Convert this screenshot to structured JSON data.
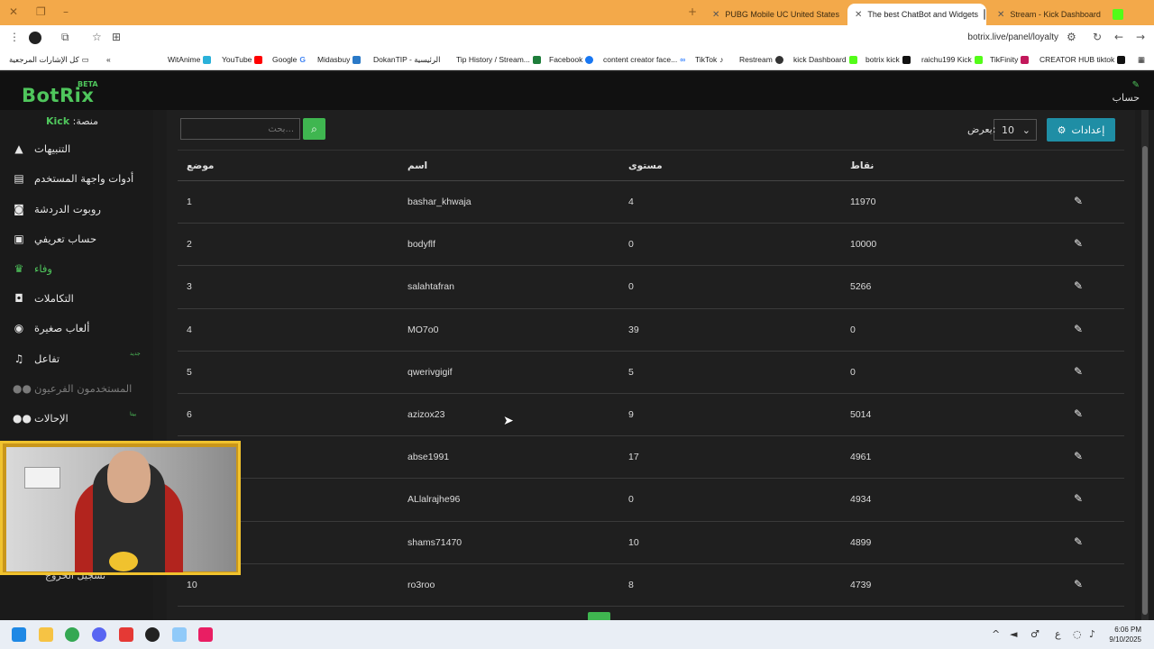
{
  "browser": {
    "tabs": [
      {
        "title": "PUBG Mobile UC United States",
        "active": false
      },
      {
        "title": "The best ChatBot and Widgets",
        "active": true
      },
      {
        "title": "Stream - Kick Dashboard",
        "active": false
      }
    ],
    "url": "botrix.live/panel/loyalty",
    "bookmarks": [
      {
        "label": "كل الإشارات المرجعية"
      },
      {
        "label": "WitAnime"
      },
      {
        "label": "YouTube"
      },
      {
        "label": "Google"
      },
      {
        "label": "Midasbuy"
      },
      {
        "label": "DokanTIP - الرئيسية"
      },
      {
        "label": "Tip History / Stream..."
      },
      {
        "label": "Facebook"
      },
      {
        "label": "content creator face..."
      },
      {
        "label": "TikTok"
      },
      {
        "label": "Restream"
      },
      {
        "label": "kick Dashboard"
      },
      {
        "label": "botrix kick"
      },
      {
        "label": "raichu199 Kick"
      },
      {
        "label": "TikFinity"
      },
      {
        "label": "CREATOR HUB tiktok"
      }
    ]
  },
  "app": {
    "logo": "BotRix",
    "beta": "BETA",
    "account_label": "حساب"
  },
  "sidebar": {
    "platform_prefix": "منصة:",
    "platform_name": "Kick",
    "items": [
      {
        "label": "التنبيهات",
        "icon": "warning-icon"
      },
      {
        "label": "أدوات واجهة المستخدم",
        "icon": "widgets-icon"
      },
      {
        "label": "روبوت الدردشة",
        "icon": "robot-icon"
      },
      {
        "label": "حساب تعريفي",
        "icon": "id-card-icon"
      },
      {
        "label": "وفاء",
        "icon": "trophy-icon"
      },
      {
        "label": "التكاملات",
        "icon": "integrations-icon"
      },
      {
        "label": "ألعاب صغيرة",
        "icon": "gamepad-icon"
      },
      {
        "label": "تفاعل",
        "icon": "music-icon"
      },
      {
        "label": "المستخدمون الفرعيون",
        "icon": "users-icon"
      },
      {
        "label": "الإحالات",
        "icon": "referrals-icon"
      }
    ],
    "new_badge": "جديد",
    "beta_badge": "بيتا",
    "partial_item": "تسجيل الخروج"
  },
  "toolbar": {
    "search_placeholder": "...بحث",
    "settings_label": "إعدادات",
    "perpage_value": "10",
    "perpage_label": "يعرض:"
  },
  "table": {
    "headers": {
      "rank": "موضع",
      "name": "اسم",
      "level": "مستوى",
      "points": "نقاط"
    },
    "rows": [
      {
        "rank": "1",
        "name": "bashar_khwaja",
        "level": "4",
        "points": "11970"
      },
      {
        "rank": "2",
        "name": "bodyflf",
        "level": "0",
        "points": "10000"
      },
      {
        "rank": "3",
        "name": "salahtafran",
        "level": "0",
        "points": "5266"
      },
      {
        "rank": "4",
        "name": "MO7o0",
        "level": "39",
        "points": "0"
      },
      {
        "rank": "5",
        "name": "qwerivgigif",
        "level": "5",
        "points": "0"
      },
      {
        "rank": "6",
        "name": "azizox23",
        "level": "9",
        "points": "5014"
      },
      {
        "rank": "",
        "name": "abse1991",
        "level": "17",
        "points": "4961"
      },
      {
        "rank": "",
        "name": "ALlalrajhe96",
        "level": "0",
        "points": "4934"
      },
      {
        "rank": "",
        "name": "shams71470",
        "level": "10",
        "points": "4899"
      },
      {
        "rank": "10",
        "name": "ro3roo",
        "level": "8",
        "points": "4739"
      }
    ]
  },
  "taskbar": {
    "time": "6:06 PM",
    "date": "9/10/2025",
    "lang": "ع"
  },
  "colors": {
    "brand_green": "#4fc65c",
    "settings_blue": "#1f8ea5",
    "chrome_orange": "#f3a94a"
  }
}
